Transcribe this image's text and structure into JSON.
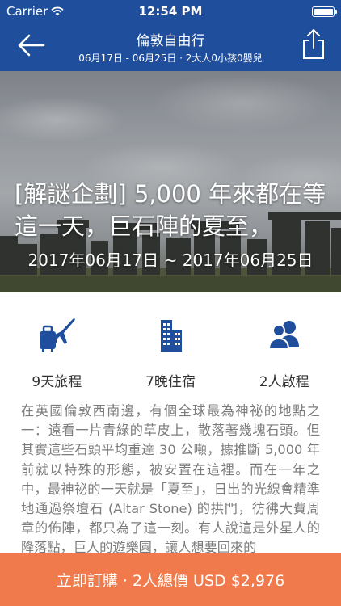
{
  "status_bar": {
    "carrier": "Carrier",
    "time": "12:54 PM",
    "battery_level": 1.0
  },
  "nav": {
    "title": "倫敦自由行",
    "subtitle": "06月17日 - 06月25日 · 2大人0小孩0嬰兒",
    "back_icon": "arrow-left-icon",
    "share_icon": "share-icon"
  },
  "hero": {
    "headline": "[解謎企劃] 5,000 年來都在等這一天，巨石陣的夏至，",
    "date_range": "2017年06月17日 ~ 2017年06月25日"
  },
  "stats": [
    {
      "icon": "luggage-plane-icon",
      "label": "9天旅程"
    },
    {
      "icon": "building-icon",
      "label": "7晚住宿"
    },
    {
      "icon": "people-icon",
      "label": "2人啟程"
    }
  ],
  "description": "在英國倫敦西南邊，有個全球最為神祕的地點之一：遠看一片青綠的草皮上，散落著幾塊石頭。但其實這些石頭平均重達 30 公噸，據推斷 5,000 年前就以特殊的形態，被安置在這裡。而在一年之中，最神祕的一天就是「夏至」，日出的光線會精準地通過祭壇石 (Altar Stone) 的拱門，彷彿大費周章的佈陣，都只為了這一刻。有人說這是外星人的降落點，巨人的遊樂園，讓人想要回來的",
  "buy_button": {
    "label": "立即訂購 · 2人總價 USD $2,976"
  },
  "colors": {
    "nav_bg": "#1f4e9c",
    "accent_icon": "#1f4e9c",
    "buy_bg": "#f07a4b",
    "desc_text": "#7b7b7b"
  }
}
